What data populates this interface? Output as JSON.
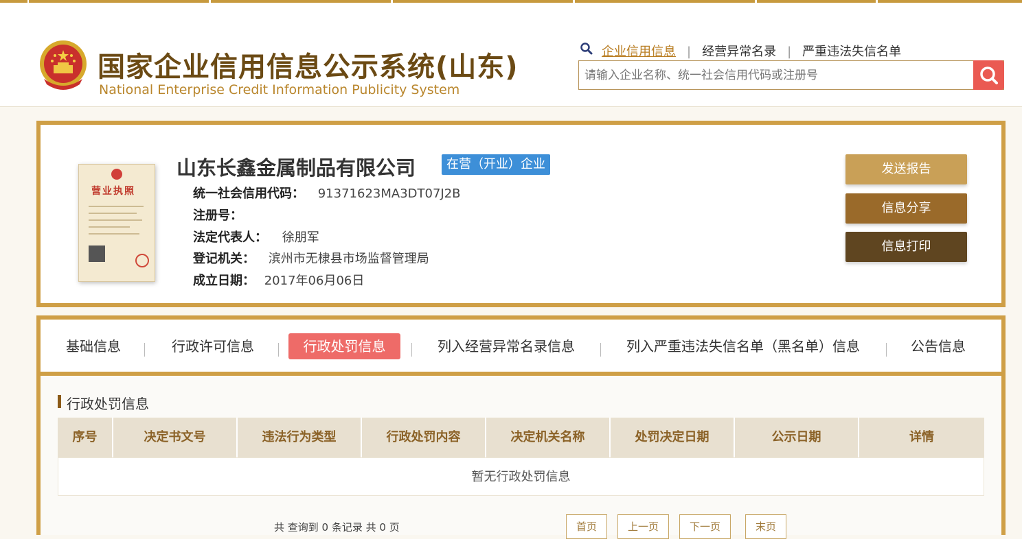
{
  "header": {
    "title": "国家企业信用信息公示系统(山东)",
    "subtitle": "National Enterprise Credit Information Publicity System",
    "nav_links": [
      "企业信用信息",
      "经营异常名录",
      "严重违法失信名单"
    ],
    "search_placeholder": "请输入企业名称、统一社会信用代码或注册号"
  },
  "company": {
    "name": "山东长鑫金属制品有限公司",
    "status": "在营（开业）企业",
    "license_title": "营业执照",
    "fields": [
      {
        "label": "统一社会信用代码：",
        "value": "91371623MA3DT07J2B"
      },
      {
        "label": "注册号：",
        "value": ""
      },
      {
        "label": "法定代表人：",
        "value": "徐朋军"
      },
      {
        "label": "登记机关：",
        "value": "滨州市无棣县市场监督管理局"
      },
      {
        "label": "成立日期：",
        "value": "2017年06月06日"
      }
    ],
    "actions": [
      "发送报告",
      "信息分享",
      "信息打印"
    ]
  },
  "tabs": [
    "基础信息",
    "行政许可信息",
    "行政处罚信息",
    "列入经营异常名录信息",
    "列入严重违法失信名单（黑名单）信息",
    "公告信息"
  ],
  "active_tab": "行政处罚信息",
  "section": {
    "title": "行政处罚信息",
    "columns": [
      "序号",
      "决定书文号",
      "违法行为类型",
      "行政处罚内容",
      "决定机关名称",
      "处罚决定日期",
      "公示日期",
      "详情"
    ],
    "empty_text": "暂无行政处罚信息"
  },
  "pagination": {
    "summary": "共 查询到 0 条记录 共 0 页",
    "buttons": [
      "首页",
      "上一页",
      "下一页",
      "末页"
    ]
  },
  "colors": {
    "brand_gold": "#cf9f46",
    "title_brown": "#6b4a14",
    "active_tab": "#ee6b68",
    "status_blue": "#3d8fd8",
    "btn_send": "#c9a057",
    "btn_share": "#9a6a2a",
    "btn_print": "#5f4520",
    "search_btn": "#ea5a52"
  }
}
